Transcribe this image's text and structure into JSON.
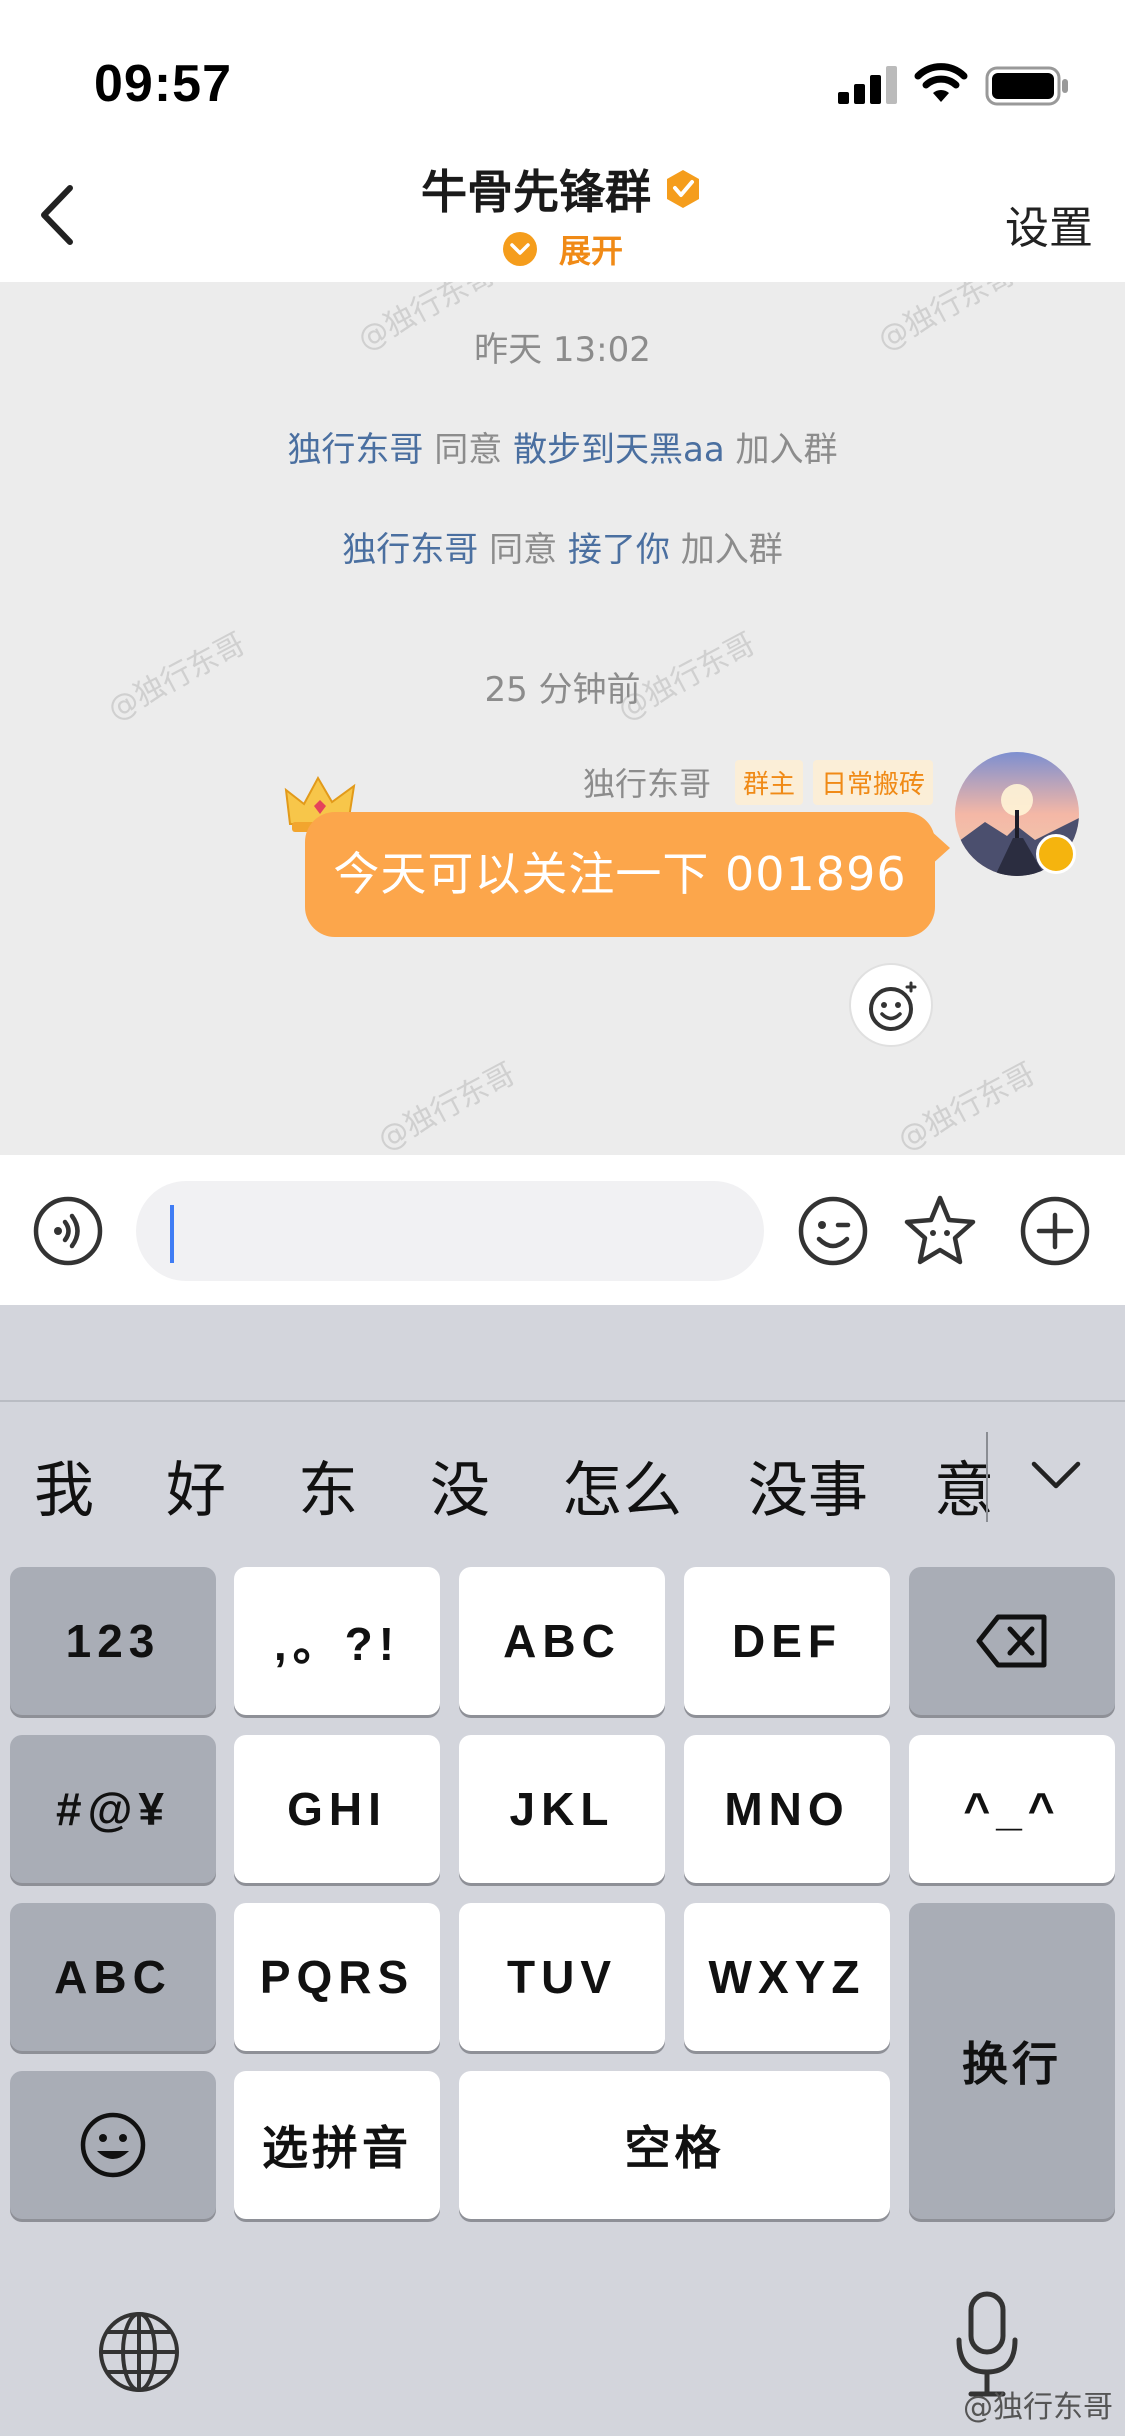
{
  "status_bar": {
    "time": "09:57"
  },
  "header": {
    "title": "牛骨先锋群",
    "expand_label": "展开",
    "settings_label": "设置"
  },
  "chat": {
    "timestamp_1": "昨天 13:02",
    "system_messages": [
      {
        "inviter": "独行东哥",
        "verb": "同意",
        "member": "散步到天黑aa",
        "action": "加入群"
      },
      {
        "inviter": "独行东哥",
        "verb": "同意",
        "member": "接了你",
        "action": "加入群"
      }
    ],
    "timestamp_2": "25 分钟前",
    "message": {
      "sender": "独行东哥",
      "badges": [
        "群主",
        "日常搬砖"
      ],
      "text": "今天可以关注一下 001896"
    },
    "watermark": "@独行东哥"
  },
  "input": {
    "value": ""
  },
  "keyboard": {
    "candidates": [
      "我",
      "好",
      "东",
      "没",
      "怎么",
      "没事",
      "意"
    ],
    "keys": {
      "num": "123",
      "punct": ",。?!",
      "abc": "ABC",
      "def": "DEF",
      "symbols": "#@¥",
      "ghi": "GHI",
      "jkl": "JKL",
      "mno": "MNO",
      "emoticon": "^_^",
      "abc_mode": "ABC",
      "pqrs": "PQRS",
      "tuv": "TUV",
      "wxyz": "WXYZ",
      "return": "换行",
      "pinyin": "选拼音",
      "space": "空格"
    }
  },
  "credit": "@独行东哥",
  "colors": {
    "accent": "#f08a16",
    "bubble": "#fca64b",
    "link": "#4a6fa0"
  }
}
